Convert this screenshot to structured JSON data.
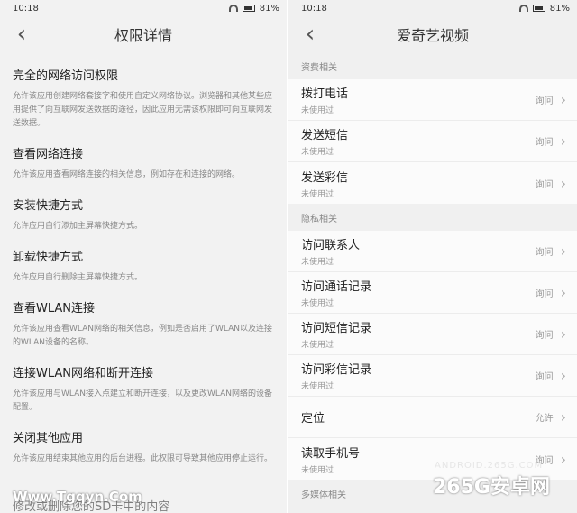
{
  "status": {
    "time": "10:18",
    "battery": "81%"
  },
  "left": {
    "title": "权限详情",
    "permissions": [
      {
        "title": "完全的网络访问权限",
        "desc": "允许该应用创建网络套接字和使用自定义网络协议。浏览器和其他某些应用提供了向互联网发送数据的途径，因此应用无需该权限即可向互联网发送数据。"
      },
      {
        "title": "查看网络连接",
        "desc": "允许该应用查看网络连接的相关信息，例如存在和连接的网络。"
      },
      {
        "title": "安装快捷方式",
        "desc": "允许应用自行添加主屏幕快捷方式。"
      },
      {
        "title": "卸载快捷方式",
        "desc": "允许应用自行删除主屏幕快捷方式。"
      },
      {
        "title": "查看WLAN连接",
        "desc": "允许该应用查看WLAN网络的相关信息，例如是否启用了WLAN以及连接的WLAN设备的名称。"
      },
      {
        "title": "连接WLAN网络和断开连接",
        "desc": "允许该应用与WLAN接入点建立和断开连接，以及更改WLAN网络的设备配置。"
      },
      {
        "title": "关闭其他应用",
        "desc": "允许该应用结束其他应用的后台进程。此权限可导致其他应用停止运行。"
      }
    ],
    "clipped_item": "修改或删除您的SD卡中的内容"
  },
  "right": {
    "title": "爱奇艺视频",
    "sections": [
      {
        "header": "资费相关",
        "rows": [
          {
            "title": "拨打电话",
            "sub": "未使用过",
            "value": "询问"
          },
          {
            "title": "发送短信",
            "sub": "未使用过",
            "value": "询问"
          },
          {
            "title": "发送彩信",
            "sub": "未使用过",
            "value": "询问"
          }
        ]
      },
      {
        "header": "隐私相关",
        "rows": [
          {
            "title": "访问联系人",
            "sub": "未使用过",
            "value": "询问"
          },
          {
            "title": "访问通话记录",
            "sub": "未使用过",
            "value": "询问"
          },
          {
            "title": "访问短信记录",
            "sub": "未使用过",
            "value": "询问"
          },
          {
            "title": "访问彩信记录",
            "sub": "未使用过",
            "value": "询问"
          },
          {
            "title": "定位",
            "sub": "",
            "value": "允许"
          },
          {
            "title": "读取手机号",
            "sub": "未使用过",
            "value": "询问"
          }
        ]
      },
      {
        "header": "多媒体相关",
        "rows": []
      }
    ]
  },
  "watermarks": {
    "site": "ANDROID.265G.COM",
    "brand": "265G安卓网",
    "left": "Www.Tgqyn.Com"
  }
}
